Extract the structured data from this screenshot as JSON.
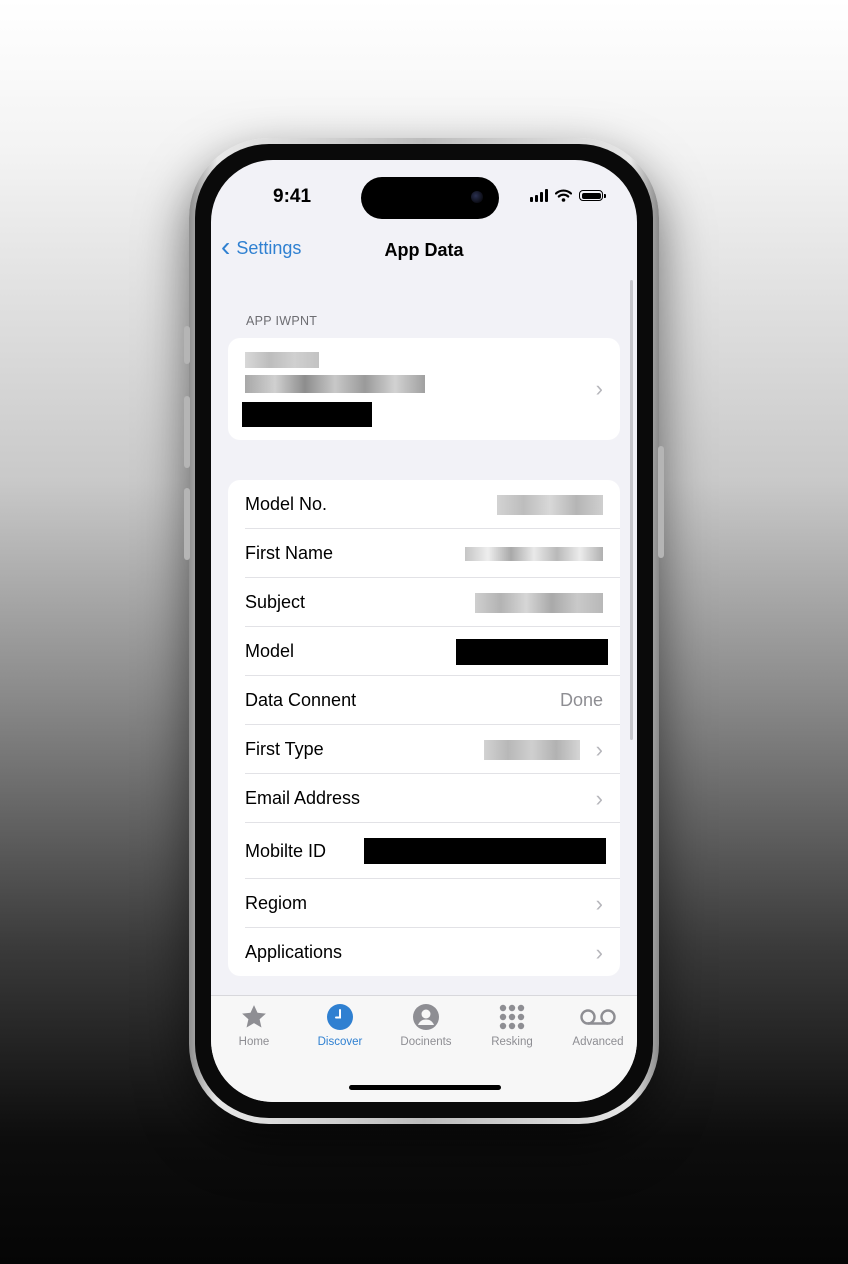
{
  "status_bar": {
    "time": "9:41"
  },
  "nav": {
    "back_label": "Settings",
    "title": "App Data"
  },
  "section_header": "APP IWPNT",
  "rows": [
    {
      "label": "Model No.",
      "value": "",
      "chevron": false
    },
    {
      "label": "First Name",
      "value": "",
      "chevron": false
    },
    {
      "label": "Subject",
      "value": "",
      "chevron": false
    },
    {
      "label": "Model",
      "value": "",
      "chevron": false
    },
    {
      "label": "Data Connent",
      "value": "Done",
      "chevron": false
    },
    {
      "label": "First Type",
      "value": "",
      "chevron": true
    },
    {
      "label": "Email Address",
      "value": "",
      "chevron": true
    },
    {
      "label": "Mobilte ID",
      "value": "",
      "chevron": false
    },
    {
      "label": "Regiom",
      "value": "",
      "chevron": true
    },
    {
      "label": "Applications",
      "value": "",
      "chevron": true
    }
  ],
  "tabs": [
    {
      "label": "Home",
      "icon": "star-icon",
      "active": false
    },
    {
      "label": "Discover",
      "icon": "clock-icon",
      "active": true
    },
    {
      "label": "Docinents",
      "icon": "person-icon",
      "active": false
    },
    {
      "label": "Resking",
      "icon": "grid-icon",
      "active": false
    },
    {
      "label": "Advanced",
      "icon": "voicemail-icon",
      "active": false
    }
  ],
  "colors": {
    "accent": "#2f80d1",
    "background": "#f2f2f7",
    "redaction": "#000000"
  }
}
